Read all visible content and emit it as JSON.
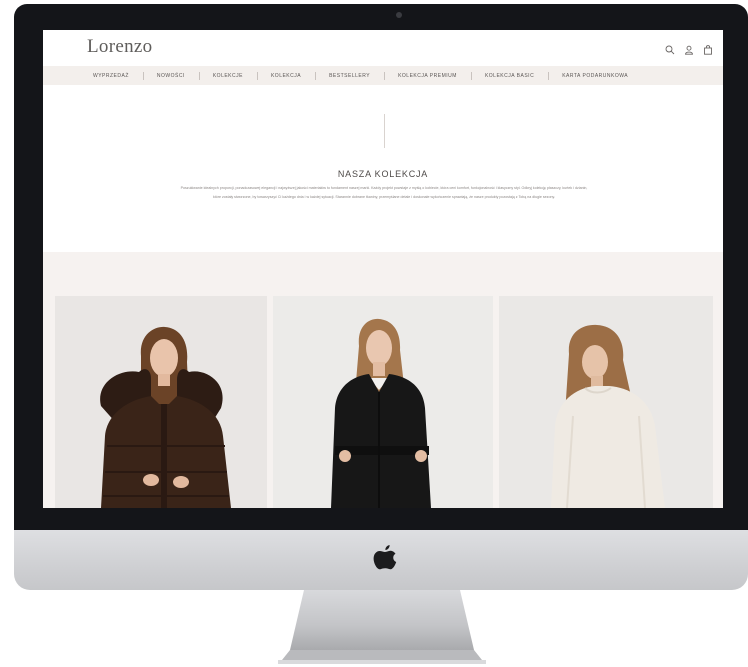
{
  "site": {
    "brand": "Lorenzo",
    "nav": {
      "items": [
        {
          "label": "WYPRZEDAŻ"
        },
        {
          "label": "NOWOŚCI"
        },
        {
          "label": "KOLEKCJE"
        },
        {
          "label": "KOLEKCJA"
        },
        {
          "label": "BESTSELLERY"
        },
        {
          "label": "KOLEKCJA PREMIUM"
        },
        {
          "label": "KOLEKCJA BASIC"
        },
        {
          "label": "KARTA PODARUNKOWA"
        }
      ]
    },
    "header_icons": [
      "search-icon",
      "user-icon",
      "shopping-bag-icon"
    ],
    "collection": {
      "title": "NASZA KOLEKCJA",
      "description": "Poszukiwanie idealnych proporcji, ponadczasowej elegancji i najwyższej jakości materiałów to fundament naszej marki. Każdy projekt powstaje z myślą o kobiecie, która ceni komfort, funkcjonalność i klasyczny styl. Odkryj kolekcję płaszczy, kurtek i dzianin, które zostały stworzone, by towarzyszyć Ci każdego dnia i w każdej sytuacji. Starannie dobrane tkaniny, przemyślane detale i doskonałe wykończenie sprawiają, że nasze produkty pozostają z Tobą na długie sezony."
    },
    "products": [
      {
        "image": "model-in-brown-fur-hood-down-jacket"
      },
      {
        "image": "model-in-black-belted-coat"
      },
      {
        "image": "model-in-cream-knit-sweater"
      }
    ]
  },
  "device": {
    "logo": "apple-logo"
  },
  "colors": {
    "bezel": "#141519",
    "nav_background": "#f3efec",
    "band_background": "#f6f2f0",
    "text": "#4e4a48"
  }
}
